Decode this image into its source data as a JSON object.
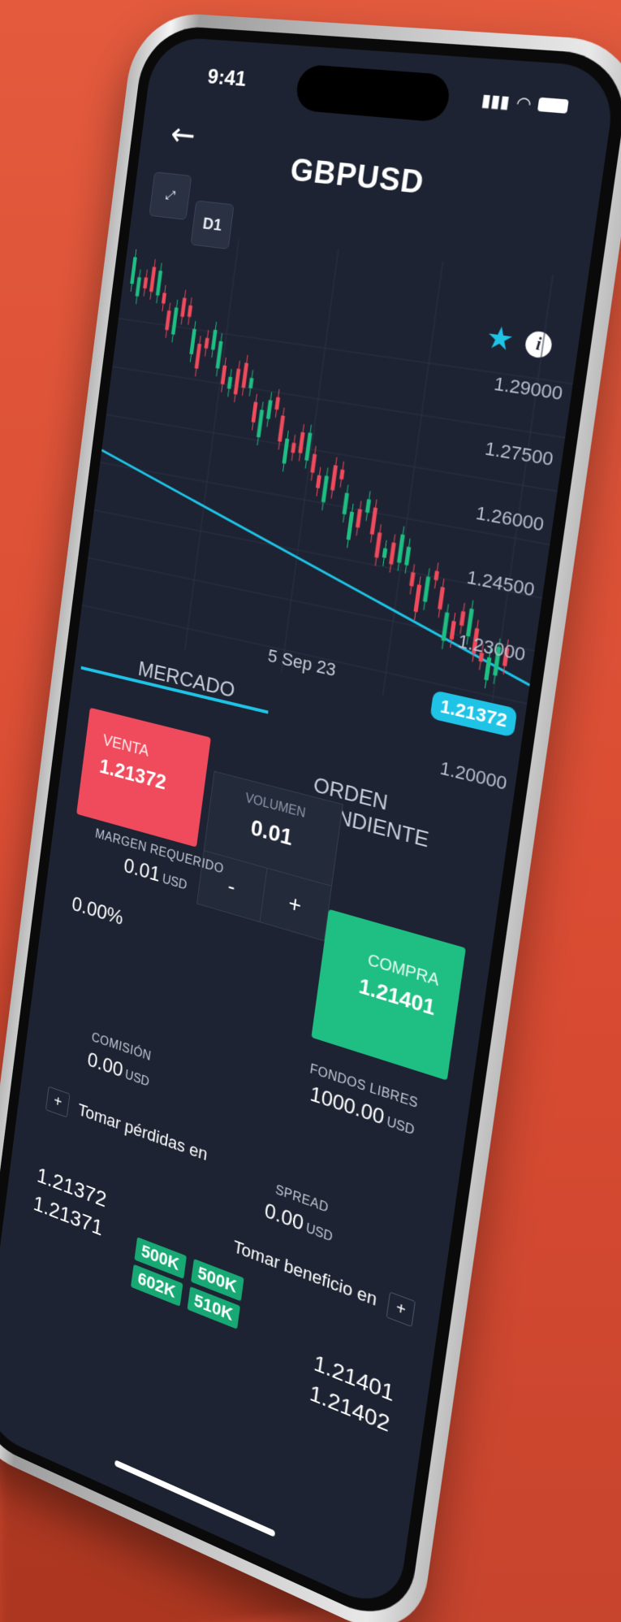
{
  "status_bar": {
    "time": "9:41"
  },
  "header": {
    "back_icon": "arrow-left-icon",
    "title": "GBPUSD",
    "fullscreen_icon": "expand-icon",
    "timeframe": "D1",
    "favorite_icon": "star-icon",
    "info_icon": "info-icon"
  },
  "chart_data": {
    "type": "candlestick",
    "y_ticks": [
      "1.29000",
      "1.27500",
      "1.26000",
      "1.24500",
      "1.23000",
      "1.20000"
    ],
    "last_price": "1.21372",
    "x_labels": [
      "5 Sep 23"
    ],
    "colors": {
      "up": "#1fbf84",
      "down": "#ef4b5c",
      "line": "#1ec3e6"
    }
  },
  "tabs": {
    "market": "MERCADO",
    "pending": "ORDEN PENDIENTE"
  },
  "sell": {
    "label": "VENTA",
    "price": "1.21372"
  },
  "buy": {
    "label": "COMPRA",
    "price": "1.21401"
  },
  "volume": {
    "label": "VOLUMEN",
    "value": "0.01",
    "minus": "-",
    "plus": "+"
  },
  "metrics": {
    "margin_label": "MARGEN REQUERIDO",
    "margin_value": "0.01",
    "margin_unit": "USD",
    "percent": "0.00%",
    "free_label": "FONDOS LIBRES",
    "free_value": "1000.00",
    "free_unit": "USD",
    "commission_label": "COMISIÓN",
    "commission_value": "0.00",
    "commission_unit": "USD",
    "spread_label": "SPREAD",
    "spread_value": "0.00",
    "spread_unit": "USD"
  },
  "stop_loss": {
    "plus": "+",
    "label": "Tomar pérdidas en"
  },
  "take_profit": {
    "label": "Tomar beneficio en",
    "plus": "+"
  },
  "quotes_left": [
    "1.21372",
    "1.21371"
  ],
  "quotes_right": [
    "1.21401",
    "1.21402"
  ],
  "depth": [
    [
      "500K",
      "500K"
    ],
    [
      "602K",
      "510K"
    ]
  ]
}
